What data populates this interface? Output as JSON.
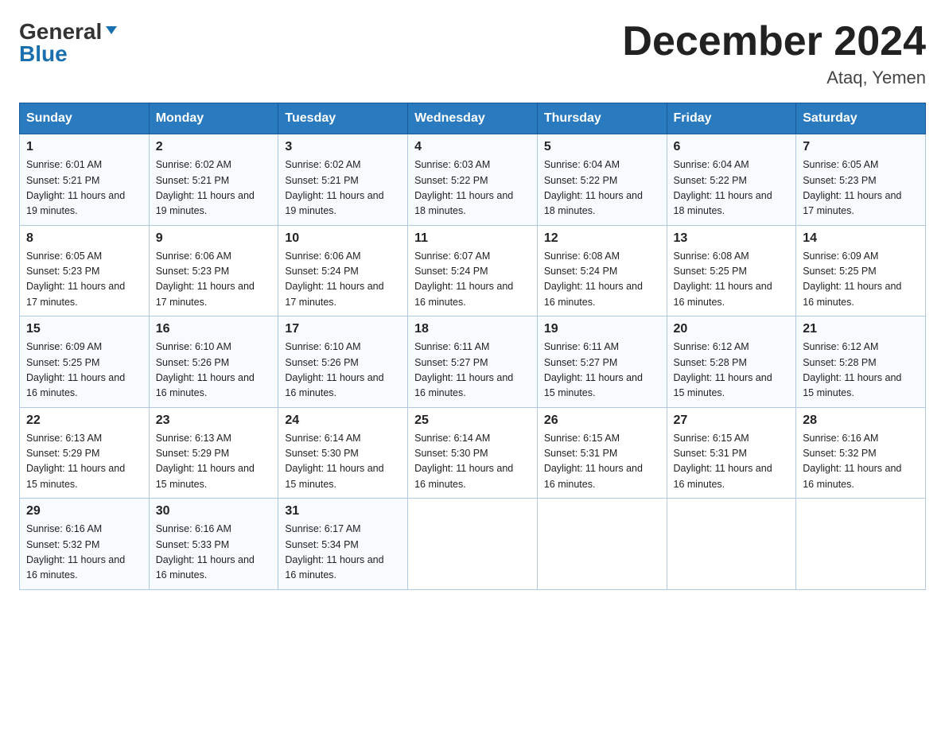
{
  "header": {
    "logo_general": "General",
    "logo_blue": "Blue",
    "title": "December 2024",
    "subtitle": "Ataq, Yemen"
  },
  "days_of_week": [
    "Sunday",
    "Monday",
    "Tuesday",
    "Wednesday",
    "Thursday",
    "Friday",
    "Saturday"
  ],
  "weeks": [
    [
      {
        "day": 1,
        "sunrise": "6:01 AM",
        "sunset": "5:21 PM",
        "daylight": "11 hours and 19 minutes."
      },
      {
        "day": 2,
        "sunrise": "6:02 AM",
        "sunset": "5:21 PM",
        "daylight": "11 hours and 19 minutes."
      },
      {
        "day": 3,
        "sunrise": "6:02 AM",
        "sunset": "5:21 PM",
        "daylight": "11 hours and 19 minutes."
      },
      {
        "day": 4,
        "sunrise": "6:03 AM",
        "sunset": "5:22 PM",
        "daylight": "11 hours and 18 minutes."
      },
      {
        "day": 5,
        "sunrise": "6:04 AM",
        "sunset": "5:22 PM",
        "daylight": "11 hours and 18 minutes."
      },
      {
        "day": 6,
        "sunrise": "6:04 AM",
        "sunset": "5:22 PM",
        "daylight": "11 hours and 18 minutes."
      },
      {
        "day": 7,
        "sunrise": "6:05 AM",
        "sunset": "5:23 PM",
        "daylight": "11 hours and 17 minutes."
      }
    ],
    [
      {
        "day": 8,
        "sunrise": "6:05 AM",
        "sunset": "5:23 PM",
        "daylight": "11 hours and 17 minutes."
      },
      {
        "day": 9,
        "sunrise": "6:06 AM",
        "sunset": "5:23 PM",
        "daylight": "11 hours and 17 minutes."
      },
      {
        "day": 10,
        "sunrise": "6:06 AM",
        "sunset": "5:24 PM",
        "daylight": "11 hours and 17 minutes."
      },
      {
        "day": 11,
        "sunrise": "6:07 AM",
        "sunset": "5:24 PM",
        "daylight": "11 hours and 16 minutes."
      },
      {
        "day": 12,
        "sunrise": "6:08 AM",
        "sunset": "5:24 PM",
        "daylight": "11 hours and 16 minutes."
      },
      {
        "day": 13,
        "sunrise": "6:08 AM",
        "sunset": "5:25 PM",
        "daylight": "11 hours and 16 minutes."
      },
      {
        "day": 14,
        "sunrise": "6:09 AM",
        "sunset": "5:25 PM",
        "daylight": "11 hours and 16 minutes."
      }
    ],
    [
      {
        "day": 15,
        "sunrise": "6:09 AM",
        "sunset": "5:25 PM",
        "daylight": "11 hours and 16 minutes."
      },
      {
        "day": 16,
        "sunrise": "6:10 AM",
        "sunset": "5:26 PM",
        "daylight": "11 hours and 16 minutes."
      },
      {
        "day": 17,
        "sunrise": "6:10 AM",
        "sunset": "5:26 PM",
        "daylight": "11 hours and 16 minutes."
      },
      {
        "day": 18,
        "sunrise": "6:11 AM",
        "sunset": "5:27 PM",
        "daylight": "11 hours and 16 minutes."
      },
      {
        "day": 19,
        "sunrise": "6:11 AM",
        "sunset": "5:27 PM",
        "daylight": "11 hours and 15 minutes."
      },
      {
        "day": 20,
        "sunrise": "6:12 AM",
        "sunset": "5:28 PM",
        "daylight": "11 hours and 15 minutes."
      },
      {
        "day": 21,
        "sunrise": "6:12 AM",
        "sunset": "5:28 PM",
        "daylight": "11 hours and 15 minutes."
      }
    ],
    [
      {
        "day": 22,
        "sunrise": "6:13 AM",
        "sunset": "5:29 PM",
        "daylight": "11 hours and 15 minutes."
      },
      {
        "day": 23,
        "sunrise": "6:13 AM",
        "sunset": "5:29 PM",
        "daylight": "11 hours and 15 minutes."
      },
      {
        "day": 24,
        "sunrise": "6:14 AM",
        "sunset": "5:30 PM",
        "daylight": "11 hours and 15 minutes."
      },
      {
        "day": 25,
        "sunrise": "6:14 AM",
        "sunset": "5:30 PM",
        "daylight": "11 hours and 16 minutes."
      },
      {
        "day": 26,
        "sunrise": "6:15 AM",
        "sunset": "5:31 PM",
        "daylight": "11 hours and 16 minutes."
      },
      {
        "day": 27,
        "sunrise": "6:15 AM",
        "sunset": "5:31 PM",
        "daylight": "11 hours and 16 minutes."
      },
      {
        "day": 28,
        "sunrise": "6:16 AM",
        "sunset": "5:32 PM",
        "daylight": "11 hours and 16 minutes."
      }
    ],
    [
      {
        "day": 29,
        "sunrise": "6:16 AM",
        "sunset": "5:32 PM",
        "daylight": "11 hours and 16 minutes."
      },
      {
        "day": 30,
        "sunrise": "6:16 AM",
        "sunset": "5:33 PM",
        "daylight": "11 hours and 16 minutes."
      },
      {
        "day": 31,
        "sunrise": "6:17 AM",
        "sunset": "5:34 PM",
        "daylight": "11 hours and 16 minutes."
      },
      null,
      null,
      null,
      null
    ]
  ],
  "labels": {
    "sunrise": "Sunrise:",
    "sunset": "Sunset:",
    "daylight": "Daylight:"
  }
}
